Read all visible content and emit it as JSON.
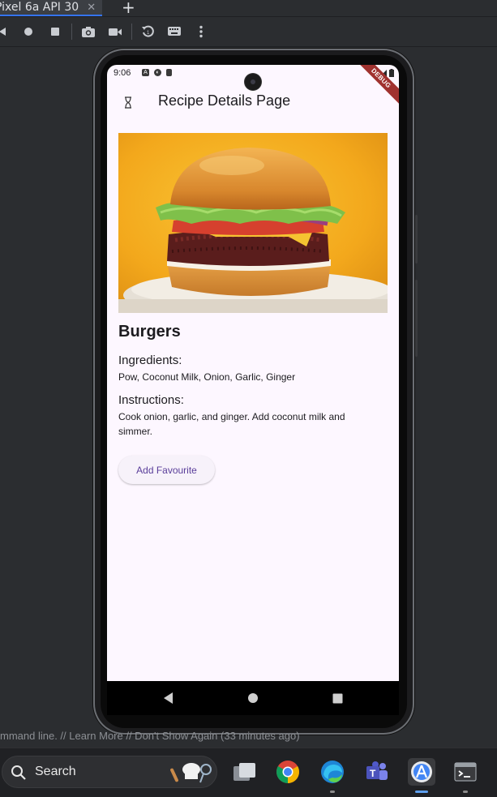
{
  "ide": {
    "tab_label": "Pixel 6a API 30",
    "tab_close": "✕",
    "tab_add": "+",
    "notice": "mmand line. // Learn More // Don't Show Again (33 minutes ago)"
  },
  "phone": {
    "time": "9:06",
    "debug_banner": "DEBUG",
    "app_title": "Recipe Details Page",
    "recipe": {
      "name": "Burgers",
      "ingredients_title": "Ingredients:",
      "ingredients": "Pow,  Coconut Milk, Onion, Garlic, Ginger",
      "instructions_title": "Instructions:",
      "instructions": "Cook onion, garlic, and ginger. Add coconut milk and simmer."
    },
    "add_favourite_label": "Add Favourite"
  },
  "taskbar": {
    "search_label": "Search",
    "apps": [
      "file-manager",
      "chrome",
      "edge",
      "teams",
      "android-studio",
      "terminal"
    ]
  },
  "colors": {
    "screen_bg": "#fdf7ff",
    "button_text": "#5a3e9a",
    "debug_ribbon": "#a0322f",
    "accent_blue": "#3574f0"
  }
}
